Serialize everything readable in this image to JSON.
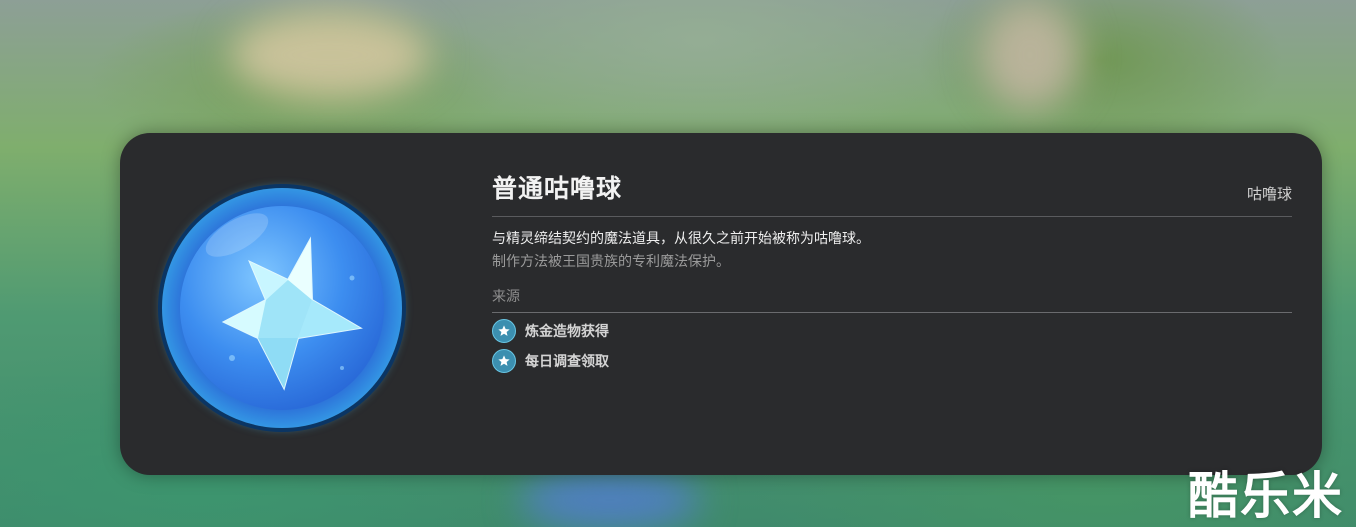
{
  "item": {
    "name": "普通咕噜球",
    "category": "咕噜球",
    "icon": "blue-orb-star-icon",
    "description_line1": "与精灵缔结契约的魔法道具，从很久之前开始被称为咕噜球。",
    "description_line2": "制作方法被王国贵族的专利魔法保护。"
  },
  "sources": {
    "label": "来源",
    "items": [
      {
        "icon": "star-badge-icon",
        "text": "炼金造物获得"
      },
      {
        "icon": "star-badge-icon",
        "text": "每日调查领取"
      }
    ]
  },
  "watermark": "酷乐米",
  "colors": {
    "card_bg": "#2a2b2d",
    "orb_blue": "#2c6fd8",
    "orb_rim": "#6fe3ff",
    "source_icon": "#3c8fb0"
  }
}
